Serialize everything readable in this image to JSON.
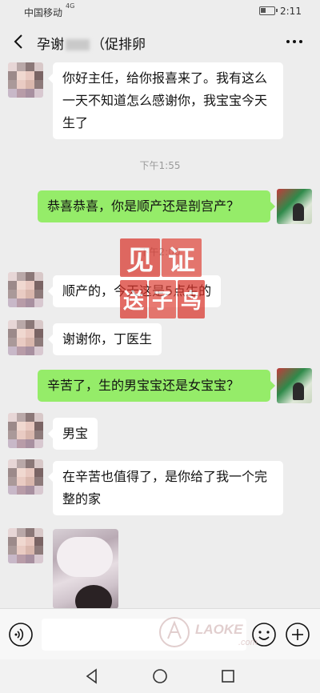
{
  "status_bar": {
    "carrier": "中国移动",
    "network": "4G",
    "time": "2:11"
  },
  "header": {
    "title_prefix": "孕谢",
    "title_suffix": "（促排卵"
  },
  "messages": [
    {
      "from": "them",
      "text": "你好主任，给你报喜来了。我有这么一天不知道怎么感谢你，我宝宝今天生了"
    },
    {
      "type": "time",
      "text": "下午1:55"
    },
    {
      "from": "me",
      "text": "恭喜恭喜，你是顺产还是剖宫产？"
    },
    {
      "type": "time",
      "text": "下午2:00"
    },
    {
      "from": "them",
      "text": "顺产的，今天这是5点生的"
    },
    {
      "from": "them",
      "text": "谢谢你，丁医生"
    },
    {
      "from": "me",
      "text": "辛苦了，生的男宝宝还是女宝宝？"
    },
    {
      "from": "them",
      "text": "男宝"
    },
    {
      "from": "them",
      "text": "在辛苦也值得了，是你给了我一个完整的家"
    },
    {
      "from": "them",
      "type": "image"
    }
  ],
  "watermark": {
    "chars": [
      "见",
      "证",
      "送",
      "子",
      "鸟"
    ]
  },
  "brand_watermark": {
    "text": "LAOKE",
    "sub": ".com"
  },
  "colors": {
    "bubble_self": "#95ec69",
    "bubble_other": "#ffffff",
    "background": "#ededed"
  }
}
